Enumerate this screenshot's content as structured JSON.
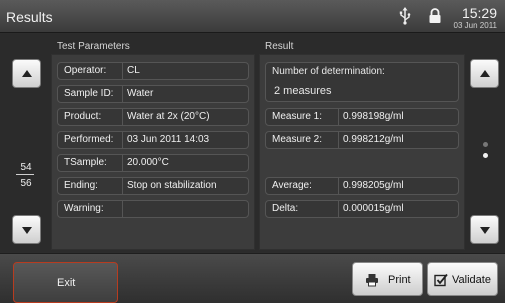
{
  "app": {
    "title": "Results"
  },
  "status": {
    "time": "15:29",
    "date": "03 Jun 2011",
    "icons": [
      "usb-icon",
      "lock-icon"
    ]
  },
  "test_parameters": {
    "title": "Test Parameters",
    "rows": [
      {
        "label": "Operator:",
        "value": "CL"
      },
      {
        "label": "Sample ID:",
        "value": "Water"
      },
      {
        "label": "Product:",
        "value": "Water at 2x (20°C)"
      },
      {
        "label": "Performed:",
        "value": "03 Jun 2011 14:03"
      },
      {
        "label": "TSample:",
        "value": "20.000°C"
      },
      {
        "label": "Ending:",
        "value": "Stop on stabilization"
      },
      {
        "label": "Warning:",
        "value": ""
      }
    ]
  },
  "result": {
    "title": "Result",
    "determination_label": "Number of determination:",
    "determination_value": "2 measures",
    "measures": [
      {
        "label": "Measure 1:",
        "value": "0.998198g/ml"
      },
      {
        "label": "Measure 2:",
        "value": "0.998212g/ml"
      }
    ],
    "average": {
      "label": "Average:",
      "value": "0.998205g/ml"
    },
    "delta": {
      "label": "Delta:",
      "value": "0.000015g/ml"
    }
  },
  "pagination": {
    "current": "54",
    "total": "56",
    "pages_shown": 2,
    "active_page": 2
  },
  "footer": {
    "exit_label": "Exit",
    "print_label": "Print",
    "validate_label": "Validate"
  },
  "colors": {
    "exit_border": "#b73c20",
    "panel": "#3c3c3c",
    "background": "#2b2b2b"
  }
}
